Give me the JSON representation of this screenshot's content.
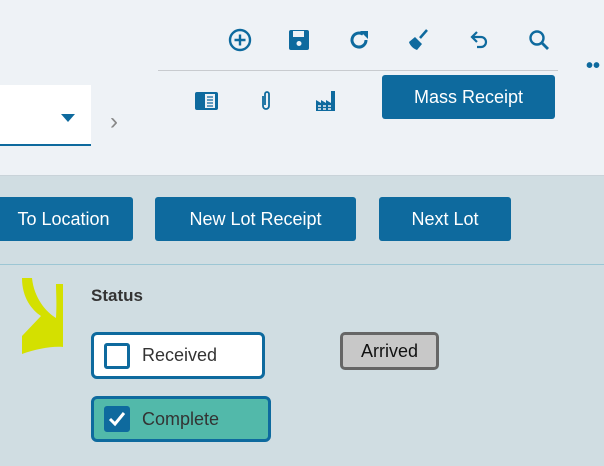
{
  "toolbar": {
    "icons": [
      "add-circle-icon",
      "save-icon",
      "refresh-icon",
      "clear-broom-icon",
      "undo-icon",
      "search-icon"
    ],
    "secondary_icons": [
      "document-panel-icon",
      "attachment-icon",
      "factory-icon"
    ],
    "mass_receipt_label": "Mass Receipt"
  },
  "actions": {
    "to_location_label": "To Location",
    "new_lot_receipt_label": "New Lot Receipt",
    "next_lot_label": "Next Lot"
  },
  "status": {
    "label": "Status",
    "received_label": "Received",
    "received_checked": false,
    "complete_label": "Complete",
    "complete_checked": true,
    "badge": "Arrived"
  },
  "colors": {
    "accent": "#0e6a9e",
    "complete_bg": "#52b9aa",
    "annotation": "#d4e000"
  }
}
